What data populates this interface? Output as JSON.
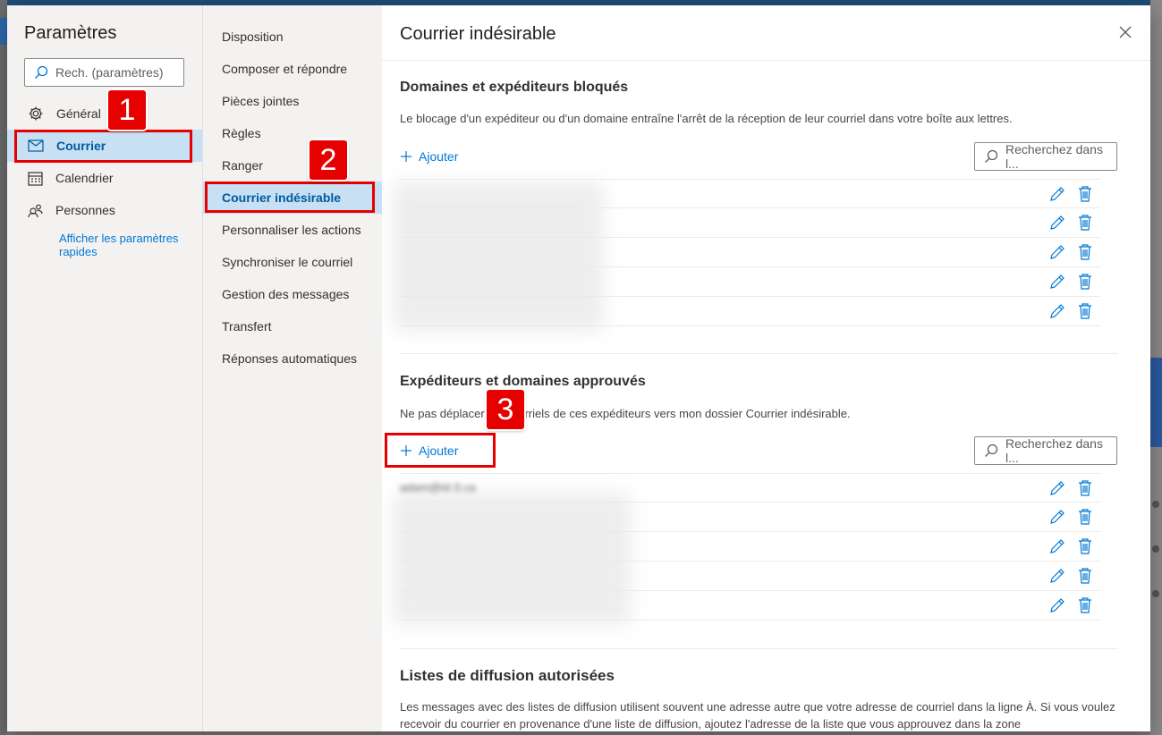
{
  "settings": {
    "title": "Paramètres",
    "search_placeholder": "Rech. (paramètres)",
    "nav": [
      {
        "label": "Général",
        "icon": "gear-icon"
      },
      {
        "label": "Courrier",
        "icon": "mail-icon"
      },
      {
        "label": "Calendrier",
        "icon": "calendar-icon"
      },
      {
        "label": "Personnes",
        "icon": "people-icon"
      }
    ],
    "quick_link": "Afficher les paramètres rapides"
  },
  "mail_nav": [
    "Disposition",
    "Composer et répondre",
    "Pièces jointes",
    "Règles",
    "Ranger",
    "Courrier indésirable",
    "Personnaliser les actions",
    "Synchroniser le courriel",
    "Gestion des messages",
    "Transfert",
    "Réponses automatiques"
  ],
  "main": {
    "title": "Courrier indésirable",
    "blocked": {
      "title": "Domaines et expéditeurs bloqués",
      "desc": "Le blocage d'un expéditeur ou d'un domaine entraîne l'arrêt de la réception de leur courriel dans votre boîte aux lettres.",
      "add_label": "Ajouter",
      "search_label": "Recherchez dans l..."
    },
    "approved": {
      "title": "Expéditeurs et domaines approuvés",
      "desc": "Ne pas déplacer les courriels de ces expéditeurs vers mon dossier Courrier indésirable.",
      "add_label": "Ajouter",
      "search_label": "Recherchez dans l...",
      "first_entry": "adam@id-3.ca"
    },
    "mailing": {
      "title": "Listes de diffusion autorisées",
      "desc": "Les messages avec des listes de diffusion utilisent souvent une adresse autre que votre adresse de courriel dans la ligne À. Si vous voulez recevoir du courrier en provenance d'une liste de diffusion, ajoutez l'adresse de la liste que vous approuvez dans la zone"
    }
  },
  "annotations": [
    "1",
    "2",
    "3"
  ],
  "colors": {
    "accent": "#0078d4",
    "highlight": "#e60000",
    "selected_bg": "#c7e0f4"
  }
}
